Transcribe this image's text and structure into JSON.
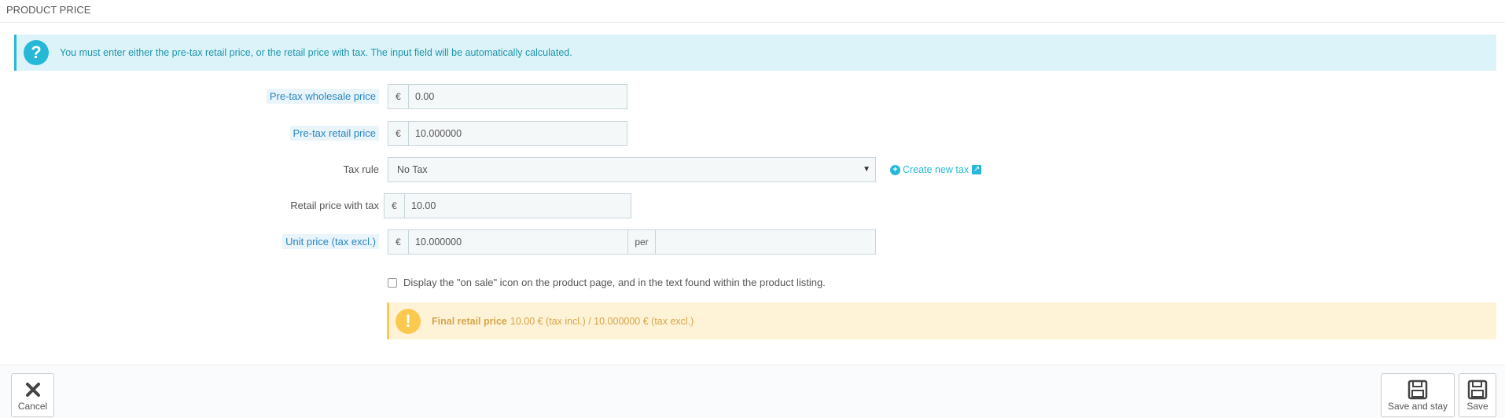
{
  "panel": {
    "title": "PRODUCT PRICE"
  },
  "info_alert": {
    "text": "You must enter either the pre-tax retail price, or the retail price with tax. The input field will be automatically calculated."
  },
  "fields": {
    "wholesale": {
      "label": "Pre-tax wholesale price",
      "currency": "€",
      "value": "0.00"
    },
    "retail": {
      "label": "Pre-tax retail price",
      "currency": "€",
      "value": "10.000000"
    },
    "tax_rule": {
      "label": "Tax rule",
      "selected": "No Tax",
      "create_label": "Create new tax"
    },
    "with_tax": {
      "label": "Retail price with tax",
      "currency": "€",
      "value": "10.00"
    },
    "unit_price": {
      "label": "Unit price (tax excl.)",
      "currency": "€",
      "value": "10.000000",
      "per_label": "per",
      "unity": ""
    }
  },
  "on_sale": {
    "label": "Display the \"on sale\" icon on the product page, and in the text found within the product listing.",
    "checked": false
  },
  "final_price": {
    "label": "Final retail price",
    "text": "10.00 € (tax incl.) / 10.000000 € (tax excl.)"
  },
  "footer": {
    "cancel_label": "Cancel",
    "save_stay_label": "Save and stay",
    "save_label": "Save"
  },
  "colors": {
    "accent": "#25b9d7",
    "warning": "#fcc94f",
    "info_bg": "#dcf4f9",
    "warning_bg": "#fff3d7"
  },
  "icons": {
    "info": "question-icon",
    "warning": "exclamation-icon",
    "cancel": "close-icon",
    "save": "floppy-disk-icon"
  }
}
